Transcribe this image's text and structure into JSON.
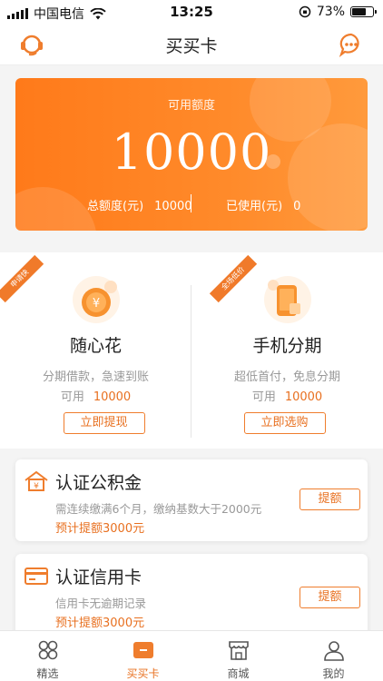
{
  "status_bar": {
    "carrier": "中国电信",
    "time": "13:25",
    "battery": "73%",
    "battery_level": 0.73
  },
  "nav": {
    "title": "买买卡",
    "left_icon": "customer-service-icon",
    "right_icon": "chat-bubble-icon"
  },
  "credit": {
    "label": "可用额度",
    "amount": "10000",
    "total_label": "总额度(元)",
    "total_value": "10000",
    "used_label": "已使用(元)",
    "used_value": "0"
  },
  "products": [
    {
      "ribbon": "申请快",
      "icon": "yuan-coin-icon",
      "name": "随心花",
      "desc": "分期借款，急速到账",
      "avail_label": "可用",
      "avail_value": "10000",
      "button": "立即提现"
    },
    {
      "ribbon": "全场低价",
      "icon": "phone-icon",
      "name": "手机分期",
      "desc": "超低首付，免息分期",
      "avail_label": "可用",
      "avail_value": "10000",
      "button": "立即选购"
    }
  ],
  "certs": [
    {
      "icon": "house-fund-icon",
      "title": "认证公积金",
      "desc": "需连续缴满6个月，缴纳基数大于2000元",
      "estimate": "预计提额3000元",
      "button": "提额"
    },
    {
      "icon": "credit-card-icon",
      "title": "认证信用卡",
      "desc": "信用卡无逾期记录",
      "estimate": "预计提额3000元",
      "button": "提额"
    }
  ],
  "tabs": [
    {
      "label": "精选",
      "icon": "grid-icon",
      "active": false
    },
    {
      "label": "买买卡",
      "icon": "card-icon",
      "active": true
    },
    {
      "label": "商城",
      "icon": "store-icon",
      "active": false
    },
    {
      "label": "我的",
      "icon": "person-icon",
      "active": false
    }
  ],
  "colors": {
    "accent": "#ef7d2d",
    "card_gradient_start": "#ff7a1a",
    "card_gradient_end": "#ff9a3c",
    "muted_text": "#999999"
  }
}
